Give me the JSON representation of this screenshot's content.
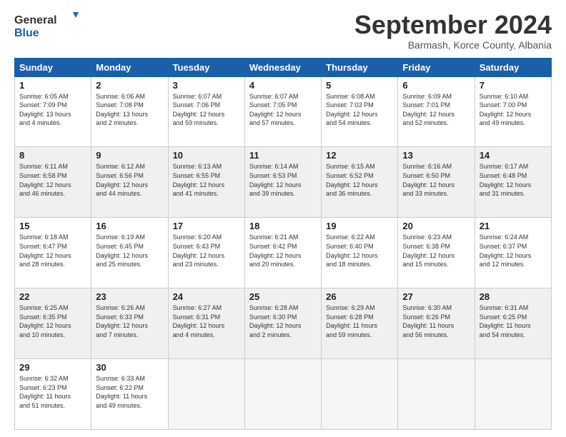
{
  "header": {
    "logo_general": "General",
    "logo_blue": "Blue",
    "month_title": "September 2024",
    "subtitle": "Barmash, Korce County, Albania"
  },
  "calendar": {
    "headers": [
      "Sunday",
      "Monday",
      "Tuesday",
      "Wednesday",
      "Thursday",
      "Friday",
      "Saturday"
    ],
    "rows": [
      [
        {
          "day": "1",
          "info": "Sunrise: 6:05 AM\nSunset: 7:09 PM\nDaylight: 13 hours\nand 4 minutes."
        },
        {
          "day": "2",
          "info": "Sunrise: 6:06 AM\nSunset: 7:08 PM\nDaylight: 13 hours\nand 2 minutes."
        },
        {
          "day": "3",
          "info": "Sunrise: 6:07 AM\nSunset: 7:06 PM\nDaylight: 12 hours\nand 59 minutes."
        },
        {
          "day": "4",
          "info": "Sunrise: 6:07 AM\nSunset: 7:05 PM\nDaylight: 12 hours\nand 57 minutes."
        },
        {
          "day": "5",
          "info": "Sunrise: 6:08 AM\nSunset: 7:03 PM\nDaylight: 12 hours\nand 54 minutes."
        },
        {
          "day": "6",
          "info": "Sunrise: 6:09 AM\nSunset: 7:01 PM\nDaylight: 12 hours\nand 52 minutes."
        },
        {
          "day": "7",
          "info": "Sunrise: 6:10 AM\nSunset: 7:00 PM\nDaylight: 12 hours\nand 49 minutes."
        }
      ],
      [
        {
          "day": "8",
          "info": "Sunrise: 6:11 AM\nSunset: 6:58 PM\nDaylight: 12 hours\nand 46 minutes."
        },
        {
          "day": "9",
          "info": "Sunrise: 6:12 AM\nSunset: 6:56 PM\nDaylight: 12 hours\nand 44 minutes."
        },
        {
          "day": "10",
          "info": "Sunrise: 6:13 AM\nSunset: 6:55 PM\nDaylight: 12 hours\nand 41 minutes."
        },
        {
          "day": "11",
          "info": "Sunrise: 6:14 AM\nSunset: 6:53 PM\nDaylight: 12 hours\nand 39 minutes."
        },
        {
          "day": "12",
          "info": "Sunrise: 6:15 AM\nSunset: 6:52 PM\nDaylight: 12 hours\nand 36 minutes."
        },
        {
          "day": "13",
          "info": "Sunrise: 6:16 AM\nSunset: 6:50 PM\nDaylight: 12 hours\nand 33 minutes."
        },
        {
          "day": "14",
          "info": "Sunrise: 6:17 AM\nSunset: 6:48 PM\nDaylight: 12 hours\nand 31 minutes."
        }
      ],
      [
        {
          "day": "15",
          "info": "Sunrise: 6:18 AM\nSunset: 6:47 PM\nDaylight: 12 hours\nand 28 minutes."
        },
        {
          "day": "16",
          "info": "Sunrise: 6:19 AM\nSunset: 6:45 PM\nDaylight: 12 hours\nand 25 minutes."
        },
        {
          "day": "17",
          "info": "Sunrise: 6:20 AM\nSunset: 6:43 PM\nDaylight: 12 hours\nand 23 minutes."
        },
        {
          "day": "18",
          "info": "Sunrise: 6:21 AM\nSunset: 6:42 PM\nDaylight: 12 hours\nand 20 minutes."
        },
        {
          "day": "19",
          "info": "Sunrise: 6:22 AM\nSunset: 6:40 PM\nDaylight: 12 hours\nand 18 minutes."
        },
        {
          "day": "20",
          "info": "Sunrise: 6:23 AM\nSunset: 6:38 PM\nDaylight: 12 hours\nand 15 minutes."
        },
        {
          "day": "21",
          "info": "Sunrise: 6:24 AM\nSunset: 6:37 PM\nDaylight: 12 hours\nand 12 minutes."
        }
      ],
      [
        {
          "day": "22",
          "info": "Sunrise: 6:25 AM\nSunset: 6:35 PM\nDaylight: 12 hours\nand 10 minutes."
        },
        {
          "day": "23",
          "info": "Sunrise: 6:26 AM\nSunset: 6:33 PM\nDaylight: 12 hours\nand 7 minutes."
        },
        {
          "day": "24",
          "info": "Sunrise: 6:27 AM\nSunset: 6:31 PM\nDaylight: 12 hours\nand 4 minutes."
        },
        {
          "day": "25",
          "info": "Sunrise: 6:28 AM\nSunset: 6:30 PM\nDaylight: 12 hours\nand 2 minutes."
        },
        {
          "day": "26",
          "info": "Sunrise: 6:29 AM\nSunset: 6:28 PM\nDaylight: 11 hours\nand 59 minutes."
        },
        {
          "day": "27",
          "info": "Sunrise: 6:30 AM\nSunset: 6:26 PM\nDaylight: 11 hours\nand 56 minutes."
        },
        {
          "day": "28",
          "info": "Sunrise: 6:31 AM\nSunset: 6:25 PM\nDaylight: 11 hours\nand 54 minutes."
        }
      ],
      [
        {
          "day": "29",
          "info": "Sunrise: 6:32 AM\nSunset: 6:23 PM\nDaylight: 11 hours\nand 51 minutes."
        },
        {
          "day": "30",
          "info": "Sunrise: 6:33 AM\nSunset: 6:22 PM\nDaylight: 11 hours\nand 49 minutes."
        },
        {
          "day": "",
          "info": ""
        },
        {
          "day": "",
          "info": ""
        },
        {
          "day": "",
          "info": ""
        },
        {
          "day": "",
          "info": ""
        },
        {
          "day": "",
          "info": ""
        }
      ]
    ]
  }
}
